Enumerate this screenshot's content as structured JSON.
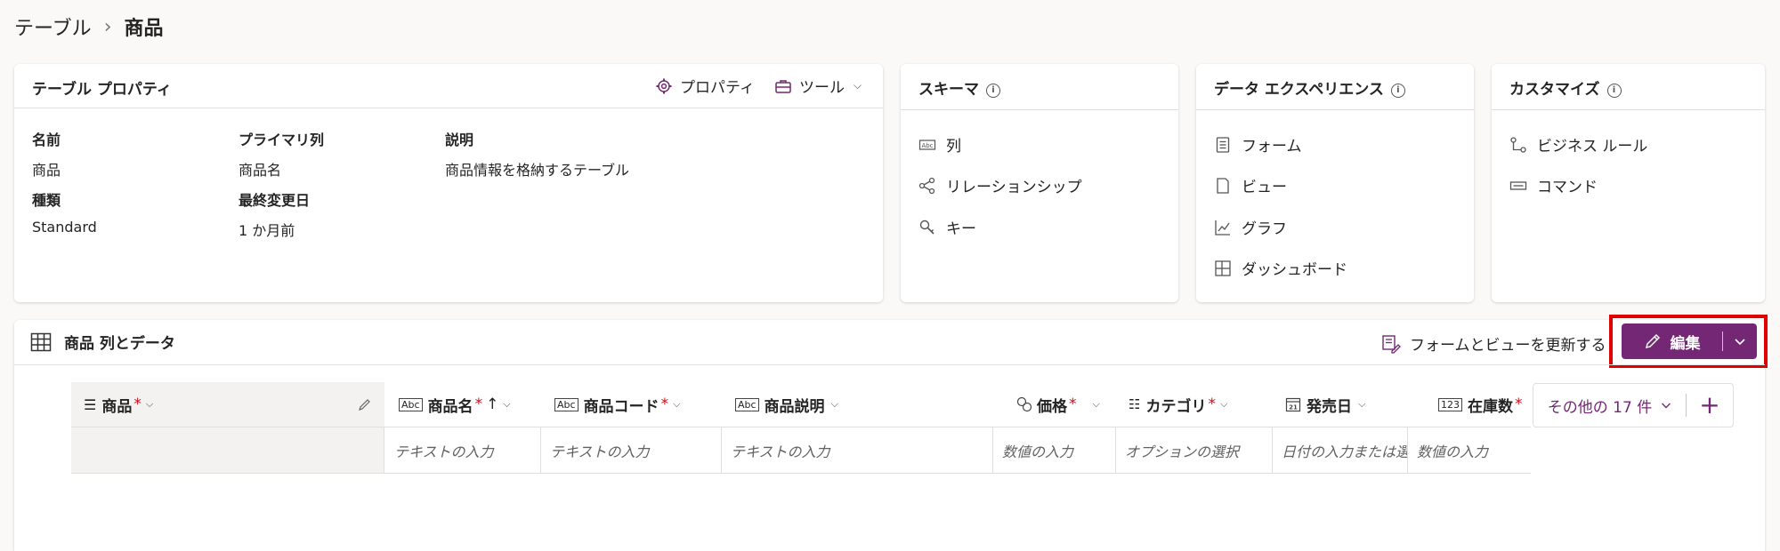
{
  "breadcrumb": {
    "parent": "テーブル",
    "separator": "›",
    "current": "商品"
  },
  "table_properties": {
    "title": "テーブル プロパティ",
    "properties_button": "プロパティ",
    "tools_button": "ツール",
    "fields": {
      "name_label": "名前",
      "name_value": "商品",
      "primary_label": "プライマリ列",
      "primary_value": "商品名",
      "desc_label": "説明",
      "desc_value": "商品情報を格納するテーブル",
      "type_label": "種類",
      "type_value": "Standard",
      "modified_label": "最終変更日",
      "modified_value": "1 か月前"
    }
  },
  "schema": {
    "title": "スキーマ",
    "items": [
      "列",
      "リレーションシップ",
      "キー"
    ]
  },
  "data_experience": {
    "title": "データ エクスペリエンス",
    "items": [
      "フォーム",
      "ビュー",
      "グラフ",
      "ダッシュボード"
    ]
  },
  "customize": {
    "title": "カスタマイズ",
    "items": [
      "ビジネス ルール",
      "コマンド"
    ]
  },
  "columns_section": {
    "title": "商品 列とデータ",
    "update_button": "フォームとビューを更新する",
    "edit_button": "編集",
    "more_columns": "その他の 17 件",
    "add_symbol": "+",
    "columns": [
      {
        "label": "商品",
        "icon": "list-icon",
        "required": "*",
        "placeholder": ""
      },
      {
        "label": "商品名",
        "icon": "abc-text-icon",
        "required": "*",
        "sort": "↑",
        "placeholder": "テキストの入力"
      },
      {
        "label": "商品コード",
        "icon": "abc-text-icon",
        "required": "*",
        "placeholder": "テキストの入力"
      },
      {
        "label": "商品説明",
        "icon": "abc-text-icon",
        "required": "",
        "placeholder": "テキストの入力"
      },
      {
        "label": "価格",
        "icon": "currency-icon",
        "required": "*",
        "placeholder": "数値の入力"
      },
      {
        "label": "カテゴリ",
        "icon": "choice-icon",
        "required": "*",
        "placeholder": "オプションの選択"
      },
      {
        "label": "発売日",
        "icon": "calendar-icon",
        "required": "",
        "placeholder": "日付の入力または選択"
      },
      {
        "label": "在庫数",
        "icon": "number-icon",
        "required": "*",
        "placeholder": "数値の入力"
      }
    ]
  },
  "colors": {
    "accent": "#742774",
    "highlight": "#e00000"
  }
}
